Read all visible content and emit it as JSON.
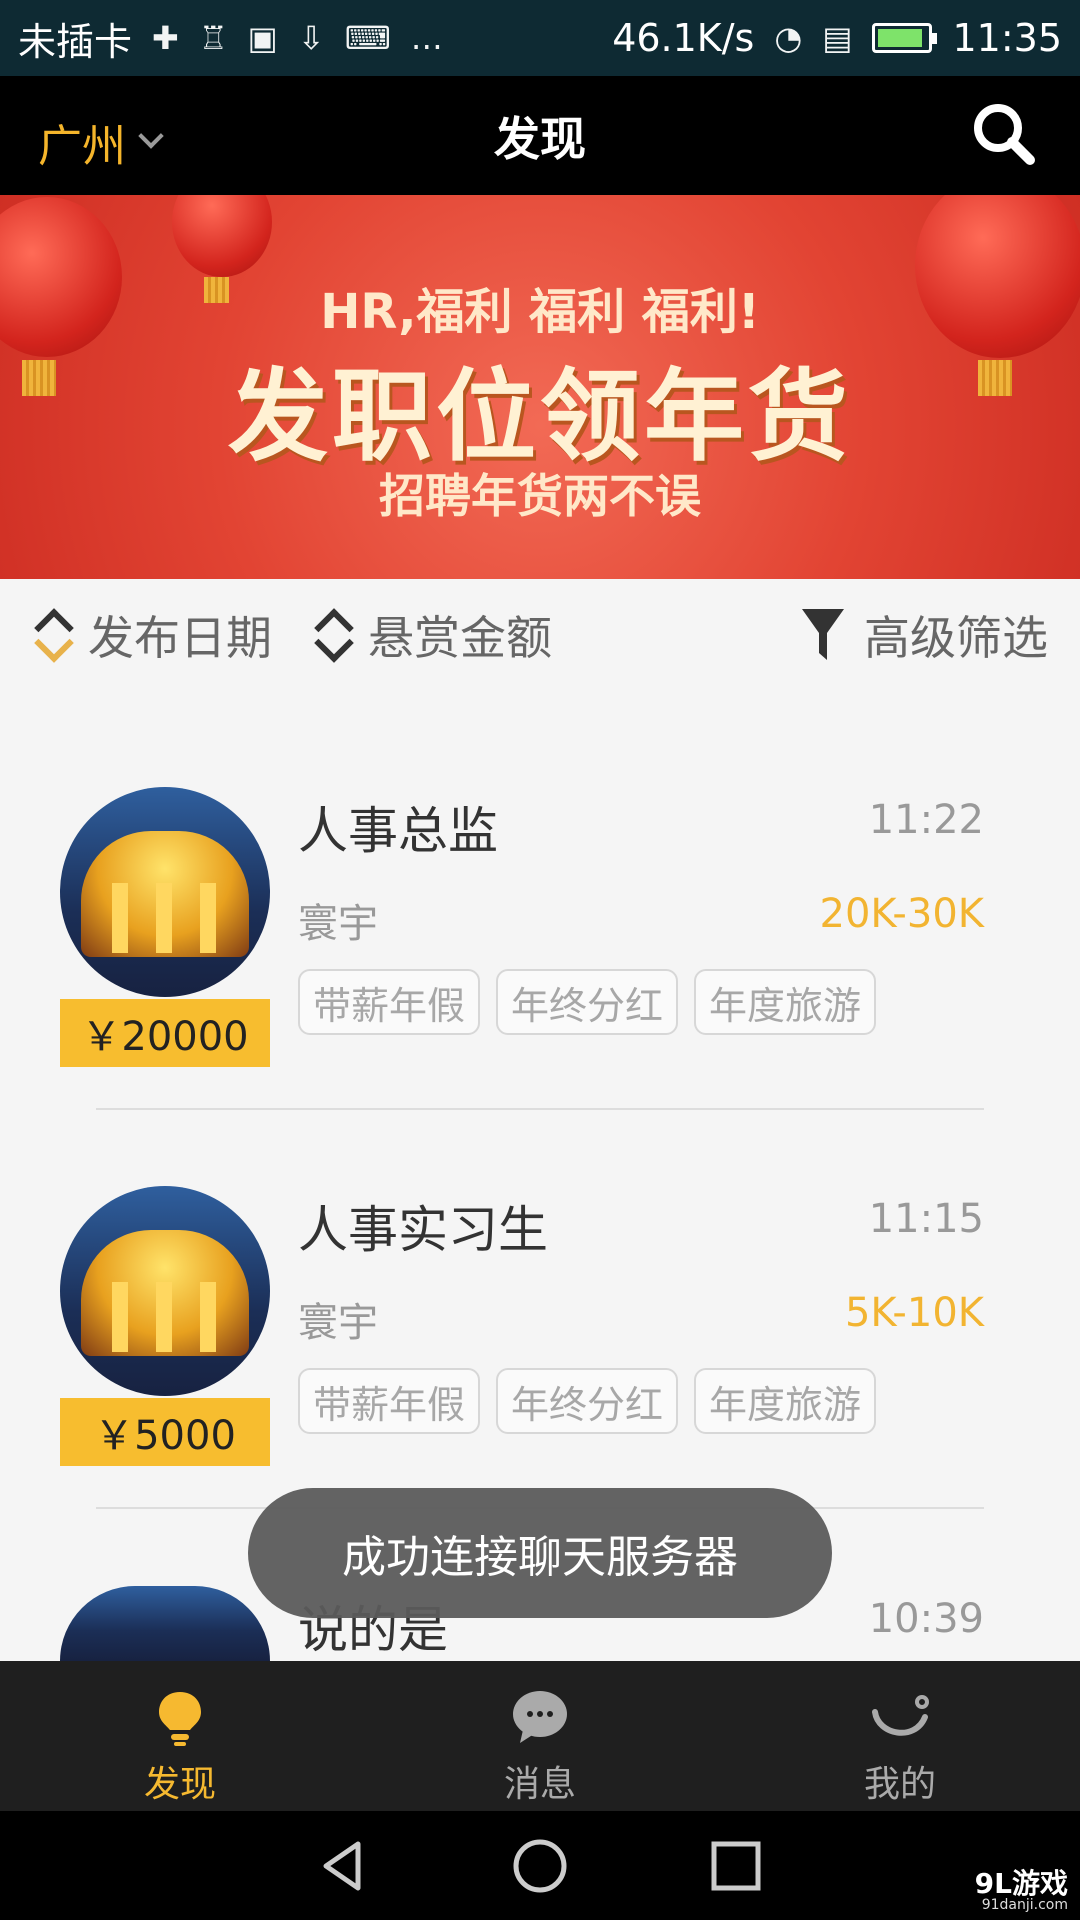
{
  "status": {
    "carrier": "未插卡",
    "network_speed": "46.1K/s",
    "time": "11:35",
    "battery_percent": 80
  },
  "header": {
    "city": "广州",
    "title": "发现"
  },
  "banner": {
    "subtitle": "HR,福利 福利 福利!",
    "headline": "发职位领年货",
    "tagline": "招聘年货两不误",
    "active_slide": 1,
    "slide_count": 5
  },
  "filters": {
    "date_label": "发布日期",
    "reward_label": "悬赏金额",
    "advanced_label": "高级筛选"
  },
  "jobs": [
    {
      "title": "人事总监",
      "time": "11:22",
      "company": "寰宇",
      "salary": "20K-30K",
      "reward": "￥20000",
      "tags": [
        "带薪年假",
        "年终分红",
        "年度旅游"
      ]
    },
    {
      "title": "人事实习生",
      "time": "11:15",
      "company": "寰宇",
      "salary": "5K-10K",
      "reward": "￥5000",
      "tags": [
        "带薪年假",
        "年终分红",
        "年度旅游"
      ]
    },
    {
      "title": "说的是",
      "time": "10:39"
    }
  ],
  "toast": "成功连接聊天服务器",
  "tabs": {
    "discover": "发现",
    "messages": "消息",
    "mine": "我的"
  },
  "watermark": {
    "main": "9L游戏",
    "sub": "91danji.com"
  },
  "colors": {
    "accent": "#f6b930",
    "header_bg": "#000000",
    "banner_red": "#e24433"
  },
  "icons": {
    "search": "search-icon",
    "discover": "lightbulb-icon",
    "messages": "chat-bubble-icon",
    "mine": "smile-icon"
  }
}
